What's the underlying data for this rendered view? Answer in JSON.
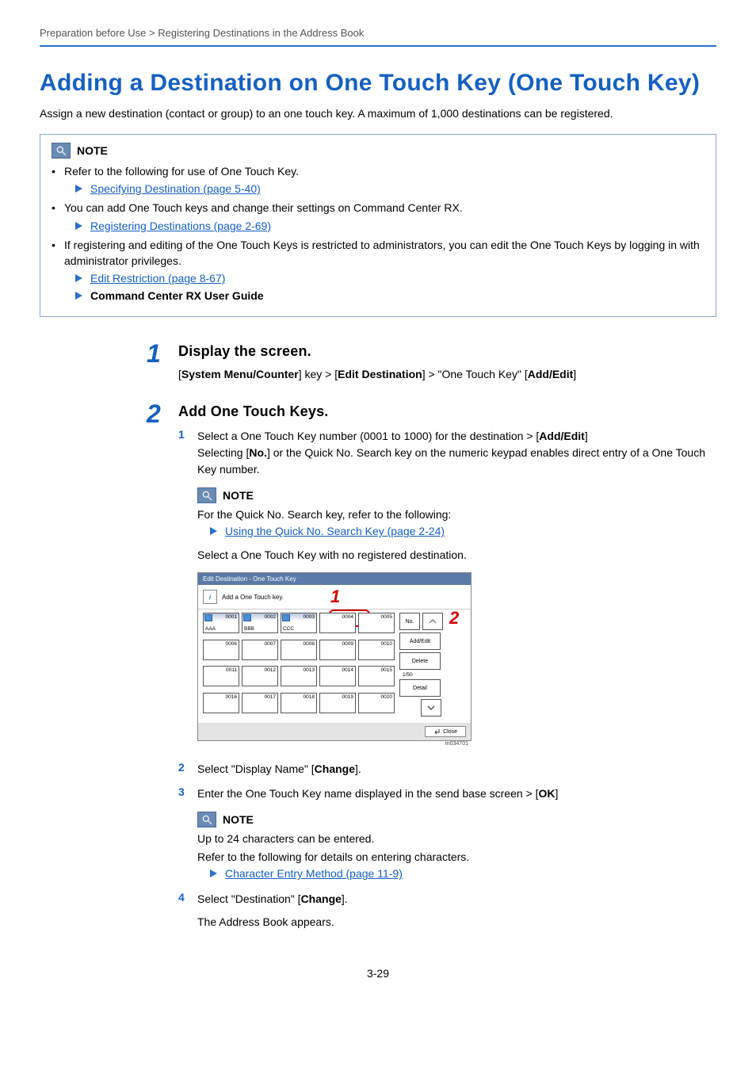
{
  "breadcrumb": "Preparation before Use > Registering Destinations in the Address Book",
  "title": "Adding a Destination on One Touch Key (One Touch Key)",
  "intro": "Assign a new destination (contact or group) to an one touch key. A maximum of 1,000 destinations can be registered.",
  "note1": {
    "label": "NOTE",
    "bullets": [
      "Refer to the following for use of One Touch Key.",
      "You can add One Touch keys and change their settings on Command Center RX.",
      "If registering and editing of the One Touch Keys is restricted to administrators, you can edit the One Touch Keys by logging in with administrator privileges."
    ],
    "link1": "Specifying Destination (page 5-40)",
    "link2": "Registering Destinations (page 2-69)",
    "link3": "Edit Restriction (page 8-67)",
    "ref4": "Command Center RX User Guide"
  },
  "step1": {
    "num": "1",
    "title": "Display the screen.",
    "path_pre": "[",
    "path_b1": "System Menu/Counter",
    "path_mid1": "] key > [",
    "path_b2": "Edit Destination",
    "path_mid2": "] > \"One Touch Key\" [",
    "path_b3": "Add/Edit",
    "path_end": "]"
  },
  "step2": {
    "num": "2",
    "title": "Add One Touch Keys.",
    "sub1": {
      "n": "1",
      "t_pre": "Select a One Touch Key number (0001 to 1000) for the destination > [",
      "t_b": "Add/Edit",
      "t_post": "]",
      "line2_pre": "Selecting [",
      "line2_b": "No.",
      "line2_post": "] or the Quick No. Search key on the numeric keypad enables direct entry of a One Touch Key number."
    },
    "note": {
      "label": "NOTE",
      "text": "For the Quick No. Search key, refer to the following:",
      "link": "Using the Quick No. Search Key (page 2-24)"
    },
    "select_text": "Select a One Touch Key with no registered destination.",
    "sub2": {
      "n": "2",
      "pre": "Select \"Display Name\" [",
      "b": "Change",
      "post": "]."
    },
    "sub3": {
      "n": "3",
      "pre": "Enter the One Touch Key name displayed in the send base screen > [",
      "b": "OK",
      "post": "]"
    },
    "note2": {
      "label": "NOTE",
      "l1": "Up to 24 characters can be entered.",
      "l2": "Refer to the following for details on entering characters.",
      "link": "Character Entry Method (page 11-9)"
    },
    "sub4": {
      "n": "4",
      "pre": "Select \"Destination\" [",
      "b": "Change",
      "post": "].",
      "after": "The Address Book appears."
    }
  },
  "screenshot": {
    "titlebar": "Edit Destination - One Touch Key",
    "info": "Add a One Touch key.",
    "callout1": "1",
    "callout2": "2",
    "cells_row1": [
      {
        "num": "0001",
        "name": "AAA",
        "icon": true
      },
      {
        "num": "0002",
        "name": "BBB",
        "icon": true
      },
      {
        "num": "0003",
        "name": "CCC",
        "icon": true
      },
      {
        "num": "0004",
        "name": ""
      },
      {
        "num": "0005",
        "name": ""
      }
    ],
    "cells_row2": [
      {
        "num": "0006"
      },
      {
        "num": "0007"
      },
      {
        "num": "0008"
      },
      {
        "num": "0009"
      },
      {
        "num": "0010"
      }
    ],
    "cells_row3": [
      {
        "num": "0011"
      },
      {
        "num": "0012"
      },
      {
        "num": "0013"
      },
      {
        "num": "0014"
      },
      {
        "num": "0015"
      }
    ],
    "cells_row4": [
      {
        "num": "0016"
      },
      {
        "num": "0017"
      },
      {
        "num": "0018"
      },
      {
        "num": "0019"
      },
      {
        "num": "0020"
      }
    ],
    "btn_no": "No.",
    "btn_addedit": "Add/Edit",
    "btn_delete": "Delete",
    "btn_detail": "Detail",
    "pager": "1/50",
    "close": "Close",
    "caption": "m034701"
  },
  "pagenum": "3-29"
}
